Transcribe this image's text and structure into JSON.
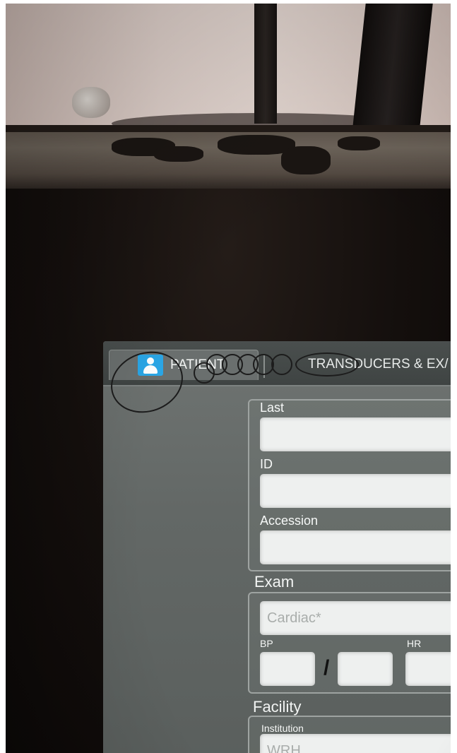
{
  "tabs": {
    "patient_label": "PATIENT",
    "transducers_label": "TRANSDUCERS & EX/"
  },
  "patient_form": {
    "last_label": "Last",
    "last_value": "",
    "id_label": "ID",
    "id_value": "",
    "accession_label": "Accession",
    "accession_value": ""
  },
  "exam": {
    "section_title": "Exam",
    "exam_type_value": "Cardiac*",
    "bp_label": "BP",
    "bp_systolic_value": "",
    "bp_diastolic_value": "",
    "bp_separator": "/",
    "hr_label": "HR",
    "hr_value": ""
  },
  "facility": {
    "section_title": "Facility",
    "institution_label": "Institution",
    "institution_value": "WRH"
  },
  "colors": {
    "patient_icon": "#2aa6e6",
    "screen_bg": "#636866",
    "input_bg": "#eef0ef"
  },
  "icons": {
    "patient_tab_icon": "person-icon"
  }
}
